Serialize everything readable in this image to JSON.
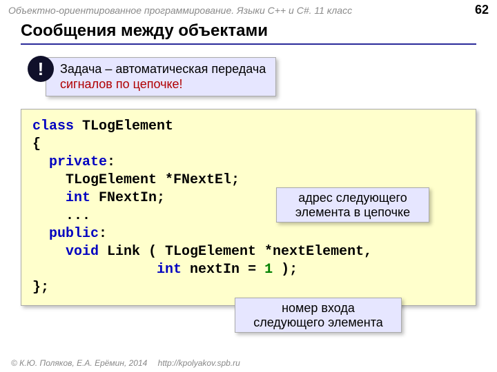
{
  "header": {
    "course": "Объектно-ориентированное программирование. Языки C++ и C#. 11 класс",
    "page": "62"
  },
  "title": "Сообщения между объектами",
  "task": {
    "bang": "!",
    "line1": "Задача – автоматическая передача",
    "line2": "сигналов по цепочке!"
  },
  "code": {
    "kw_class": "class",
    "class_name": " TLogElement",
    "brace_open": "{",
    "kw_private": "  private",
    "colon1": ":",
    "line_fnextel": "    TLogElement *FNextEl;",
    "kw_int1": "    int",
    "fnextin": " FNextIn;",
    "dots": "    ...",
    "kw_public": "  public",
    "colon2": ":",
    "kw_void": "    void",
    "link_part": " Link ( TLogElement *nextElement,",
    "kw_int2": "               int",
    "nextin_part": " nextIn = ",
    "one": "1",
    "end_paren": " );",
    "brace_close": "};"
  },
  "callout1": {
    "l1": "адрес следующего",
    "l2": "элемента в цепочке"
  },
  "callout2": {
    "l1": "номер входа",
    "l2": "следующего элемента"
  },
  "footer": {
    "authors": "© К.Ю. Поляков, Е.А. Ерёмин, 2014",
    "url": "http://kpolyakov.spb.ru"
  }
}
